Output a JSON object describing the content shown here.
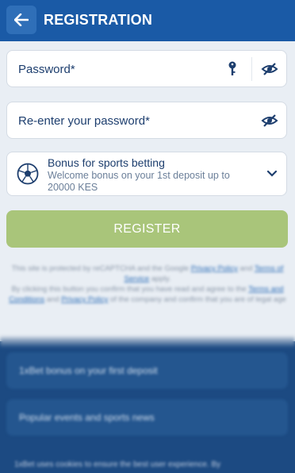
{
  "header": {
    "title": "REGISTRATION",
    "back_icon": "arrow-left-icon",
    "bg_color": "#1a5aa6"
  },
  "form": {
    "password_placeholder": "Password*",
    "reenter_placeholder": "Re-enter your password*",
    "bonus": {
      "title": "Bonus for sports betting",
      "subtitle": "Welcome bonus on your 1st deposit up to 20000 KES",
      "icon": "soccer-ball-icon"
    },
    "register_label": "REGISTER",
    "register_color": "#a9c57a"
  },
  "legal": {
    "line1": "This site is protected by reCAPTCHA and the Google",
    "privacy_link": "Privacy Policy",
    "and": "and",
    "terms_link": "Terms of Service",
    "apply": "apply.",
    "line2": "By clicking this button you confirm that you have read and agree to the",
    "terms_conditions_link": "Terms and Conditions",
    "and2": "and",
    "privacy_link2": "Privacy Policy",
    "line3": "of the company and confirm that you are of legal age"
  },
  "footer": {
    "card1": "1xBet bonus on your first deposit",
    "card2": "Popular events and sports news",
    "bottom_text": "1xBet uses cookies to ensure the best user experience. By"
  }
}
